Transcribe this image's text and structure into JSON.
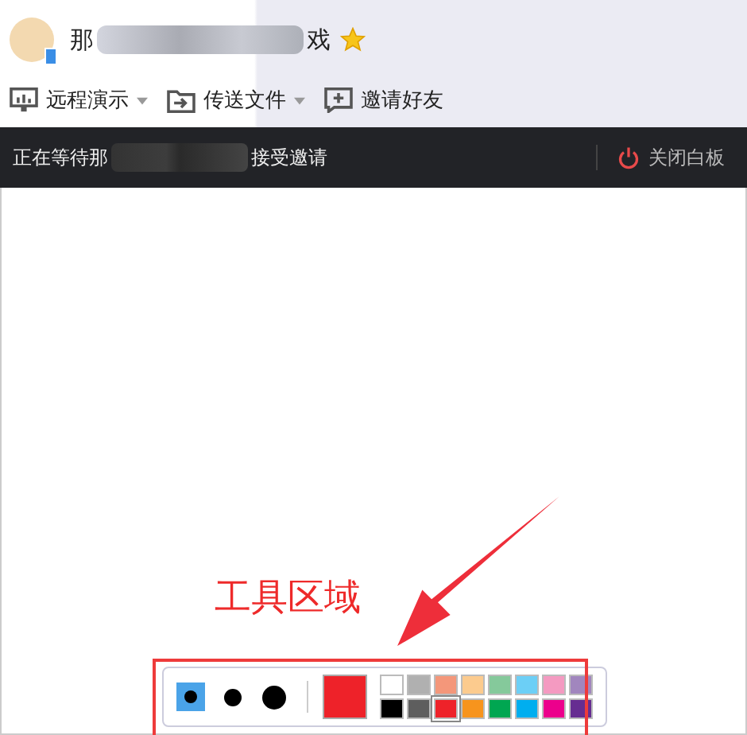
{
  "contact": {
    "name_start": "那",
    "name_end": "戏"
  },
  "toolbar": [
    {
      "kind": "screen",
      "label": "远程演示",
      "dropdown": true
    },
    {
      "kind": "file",
      "label": "传送文件",
      "dropdown": true
    },
    {
      "kind": "invite",
      "label": "邀请好友",
      "dropdown": false
    }
  ],
  "status_bar": {
    "text_start": "正在等待那",
    "text_end": "接受邀请",
    "close_label": "关闭白板"
  },
  "pen_sizes": [
    {
      "kind": "small",
      "selected": true
    },
    {
      "kind": "medium",
      "selected": false
    },
    {
      "kind": "large",
      "selected": false
    }
  ],
  "palette": [
    {
      "color": "#ffffff",
      "selected": false
    },
    {
      "color": "#b0b0b0",
      "selected": false
    },
    {
      "color": "#f4977a",
      "selected": false
    },
    {
      "color": "#fccb8e",
      "selected": false
    },
    {
      "color": "#85c99b",
      "selected": false
    },
    {
      "color": "#6ccff6",
      "selected": false
    },
    {
      "color": "#f49ac1",
      "selected": false
    },
    {
      "color": "#a186be",
      "selected": false
    },
    {
      "color": "#000000",
      "selected": false
    },
    {
      "color": "#5e5e5e",
      "selected": false
    },
    {
      "color": "#ee2229",
      "selected": true
    },
    {
      "color": "#f7941d",
      "selected": false
    },
    {
      "color": "#00a651",
      "selected": false
    },
    {
      "color": "#00aeef",
      "selected": false
    },
    {
      "color": "#ec008c",
      "selected": false
    },
    {
      "color": "#662d91",
      "selected": false
    }
  ],
  "annotation": {
    "label": "工具区域"
  }
}
